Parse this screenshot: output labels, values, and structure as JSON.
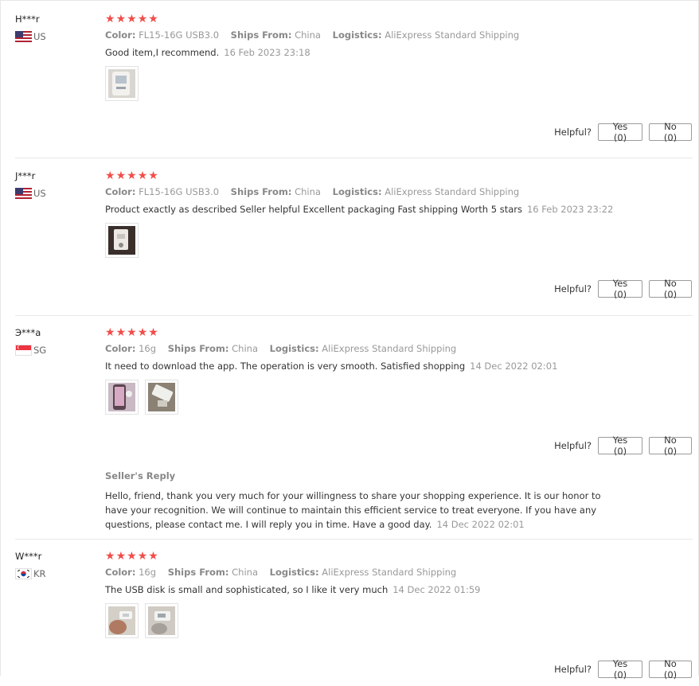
{
  "colors": {
    "star": "#f14d4a",
    "meta_key": "#888888",
    "meta_value": "#999999",
    "date": "#999999",
    "divider": "#e8e8e8"
  },
  "labels": {
    "color": "Color:",
    "ships_from": "Ships From:",
    "logistics": "Logistics:",
    "helpful": "Helpful?",
    "seller_reply": "Seller's Reply"
  },
  "reviews": [
    {
      "user": "H***r",
      "country": "US",
      "flag_icon": "us-flag-icon",
      "rating": 5,
      "color_value": "FL15-16G USB3.0",
      "ships_from_value": "China",
      "logistics_value": "AliExpress Standard Shipping",
      "text": "Good item,I recommend.",
      "date": "16 Feb 2023 23:18",
      "photos": 1,
      "yes_label": "Yes (0)",
      "no_label": "No (0)"
    },
    {
      "user": "J***r",
      "country": "US",
      "flag_icon": "us-flag-icon",
      "rating": 5,
      "color_value": "FL15-16G USB3.0",
      "ships_from_value": "China",
      "logistics_value": "AliExpress Standard Shipping",
      "text": "Product exactly as described Seller helpful Excellent packaging Fast shipping Worth 5 stars",
      "date": "16 Feb 2023 23:22",
      "photos": 1,
      "yes_label": "Yes (0)",
      "no_label": "No (0)"
    },
    {
      "user": "Э***a",
      "country": "SG",
      "flag_icon": "sg-flag-icon",
      "rating": 5,
      "color_value": "16g",
      "ships_from_value": "China",
      "logistics_value": "AliExpress Standard Shipping",
      "text": "It need to download the app. The operation is very smooth. Satisfied shopping",
      "date": "14 Dec 2022 02:01",
      "photos": 2,
      "yes_label": "Yes (0)",
      "no_label": "No (0)",
      "reply_line1": "Hello, friend, thank you very much for your willingness to share your shopping experience. It is our honor to",
      "reply_line2": "have your recognition. We will continue to maintain this efficient service to treat everyone. If you have any",
      "reply_line3": "questions, please contact me. I will reply you in time. Have a good day.",
      "reply_date": "14 Dec 2022 02:01"
    },
    {
      "user": "W***r",
      "country": "KR",
      "flag_icon": "kr-flag-icon",
      "rating": 5,
      "color_value": "16g",
      "ships_from_value": "China",
      "logistics_value": "AliExpress Standard Shipping",
      "text": "The USB disk is small and sophisticated, so I like it very much",
      "date": "14 Dec 2022 01:59",
      "photos": 2,
      "yes_label": "Yes (0)",
      "no_label": "No (0)"
    }
  ]
}
